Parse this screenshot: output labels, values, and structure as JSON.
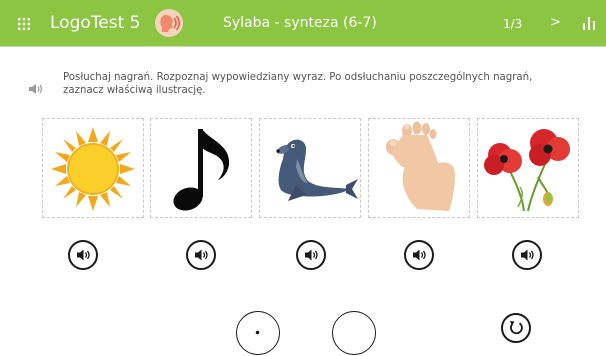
{
  "header": {
    "app_title": "LogoTest 5",
    "exercise_title": "Sylaba - synteza (6-7)",
    "page_counter": "1/3",
    "next_label": ">",
    "accent_color": "#8cc542"
  },
  "instruction": {
    "text": "Posłuchaj nagrań. Rozpoznaj wypowiedziany wyraz. Po odsłuchaniu poszczególnych nagrań, zaznacz właściwą ilustrację."
  },
  "cards": [
    {
      "image": "sun",
      "play_icon": "speaker-icon"
    },
    {
      "image": "musical-note",
      "play_icon": "speaker-icon"
    },
    {
      "image": "seal",
      "play_icon": "speaker-icon"
    },
    {
      "image": "foot",
      "play_icon": "speaker-icon"
    },
    {
      "image": "poppies",
      "play_icon": "speaker-icon"
    }
  ],
  "icons": {
    "menu": "grid-menu-icon",
    "stats": "bar-chart-icon",
    "restart": "restart-icon"
  }
}
